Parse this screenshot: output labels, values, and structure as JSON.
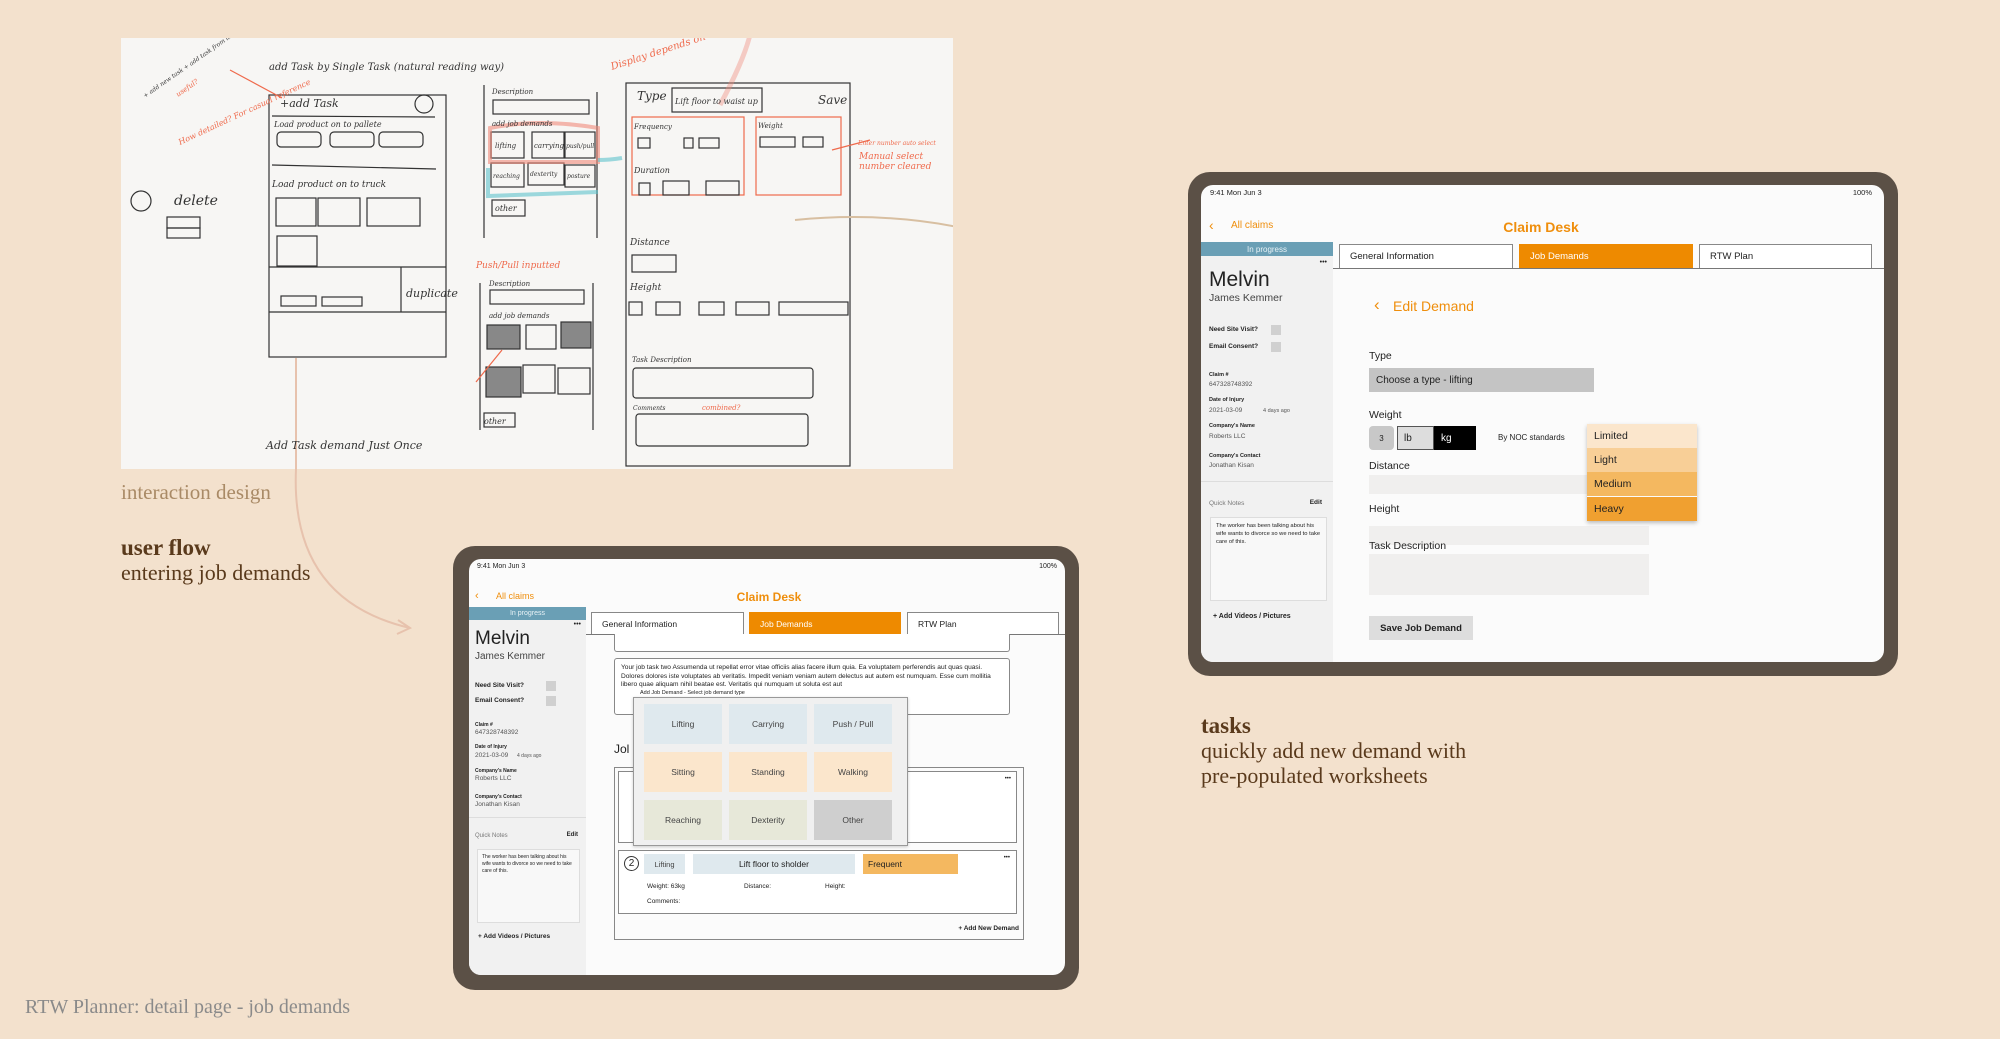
{
  "sketch": {
    "labels": {
      "top_note": "add Task by Single Task (natural reading way)",
      "add_task": "+add Task",
      "load_pallet": "Load product on to pallete",
      "load_truck": "Load product on to truck",
      "delete": "delete",
      "duplicate": "duplicate",
      "description": "Description",
      "add_job_demands": "add job demands",
      "lifting": "lifting",
      "carrying": "carrying",
      "push_pull": "push/pull",
      "reaching": "reaching",
      "dexterity": "dexterity",
      "posture": "posture",
      "other": "other",
      "type": "Type",
      "type_value": "Lift floor to waist up",
      "save": "Save",
      "frequency": "Frequency",
      "duration": "Duration",
      "weight": "Weight",
      "distance": "Distance",
      "height": "Height",
      "task_description": "Task Description",
      "comments": "Comments",
      "bottom_note": "Add Task demand Just Once",
      "note_display": "Display depends on category",
      "note_pushpull": "Push/Pull inputted",
      "note_detailed": "How detailed? For casual reference",
      "note_add": "+ add new task + add task from library + duplicate existing task?",
      "note_useful": "useful?",
      "note_enter": "Enter number auto select",
      "note_manual": "Manual select number cleared",
      "note_combined": "combined?"
    }
  },
  "captions": {
    "interaction": "interaction design",
    "flow_title": "user flow",
    "flow_sub": "entering job demands",
    "tasks_title": "tasks",
    "tasks_sub1": "quickly add new demand with",
    "tasks_sub2": "pre-populated worksheets",
    "footer": "RTW Planner: detail page - job demands"
  },
  "app": {
    "status_time": "9:41  Mon Jun 3",
    "battery": "100%",
    "back_label": "All claims",
    "title": "Claim Desk",
    "status_badge": "In progress",
    "tabs": [
      "General Information",
      "Job Demands",
      "RTW Plan"
    ],
    "active_tab": "Job Demands",
    "claimant": {
      "first": "Melvin",
      "full": "James Kemmer",
      "need_site_visit": "Need Site Visit?",
      "email_consent": "Email Consent?",
      "claim_label": "Claim #",
      "claim_value": "647328748392",
      "doi_label": "Date of Injury",
      "doi_value": "2021-03-09",
      "doi_ago": "4 days ago",
      "company_label": "Company's Name",
      "company_value": "Roberts LLC",
      "contact_label": "Company's Contact",
      "contact_value": "Jonathan Kisan",
      "notes_label": "Quick Notes",
      "notes_edit": "Edit",
      "notes_text": "The worker has been talking about his wife wants to divorce so we need to take care of this.",
      "add_media": "+ Add Videos / Pictures"
    },
    "colors": {
      "accent": "#ee8a00",
      "badge": "#6a9fb5",
      "frame": "#5b5046"
    }
  },
  "flow_screen": {
    "task_text": "Your job task two  Assumenda ut repellat error vitae officiis alias facere illum quia. Ea voluptatem perferendis aut quas quasi. Dolores dolores iste voluptates ab veritatis. Impedit veniam veniam autem delectus aut autem est numquam. Esse cum mollitia libero quae aliquam nihil beatae est. Veritatis qui numquam ut soluta est aut",
    "modal_title": "Add Job Demand - Select job demand type",
    "types": [
      {
        "label": "Lifting",
        "color": "#dfe9ee"
      },
      {
        "label": "Carrying",
        "color": "#dfe9ee"
      },
      {
        "label": "Push / Pull",
        "color": "#dfe9ee"
      },
      {
        "label": "Sitting",
        "color": "#fbe6cc"
      },
      {
        "label": "Standing",
        "color": "#fbe6cc"
      },
      {
        "label": "Walking",
        "color": "#fbe6cc"
      },
      {
        "label": "Reaching",
        "color": "#e7e8d9"
      },
      {
        "label": "Dexterity",
        "color": "#e7e8d9"
      },
      {
        "label": "Other",
        "color": "#cfcfcf"
      }
    ],
    "section_heading_partial": "Jol",
    "demand2": {
      "number": "2",
      "type": "Lifting",
      "name": "Lift floor to sholder",
      "frequency": "Frequent",
      "weight": "Weight: 63kg",
      "distance": "Distance:",
      "height": "Height:",
      "comments": "Comments:"
    },
    "add_new": "+ Add New Demand",
    "more": "•••"
  },
  "edit_screen": {
    "heading": "Edit Demand",
    "type_label": "Type",
    "type_value": "Choose a type - lifting",
    "weight_label": "Weight",
    "weight_value": "3",
    "unit_lb": "lb",
    "unit_kg": "kg",
    "selected_unit": "kg",
    "noc_label": "By NOC standards",
    "levels": [
      {
        "label": "Limited",
        "color": "#fbe6cc"
      },
      {
        "label": "Light",
        "color": "#f8cf97"
      },
      {
        "label": "Medium",
        "color": "#f4b860"
      },
      {
        "label": "Heavy",
        "color": "#f0a030"
      }
    ],
    "distance_label": "Distance",
    "height_label": "Height",
    "task_desc_label": "Task Description",
    "save_label": "Save Job Demand"
  }
}
